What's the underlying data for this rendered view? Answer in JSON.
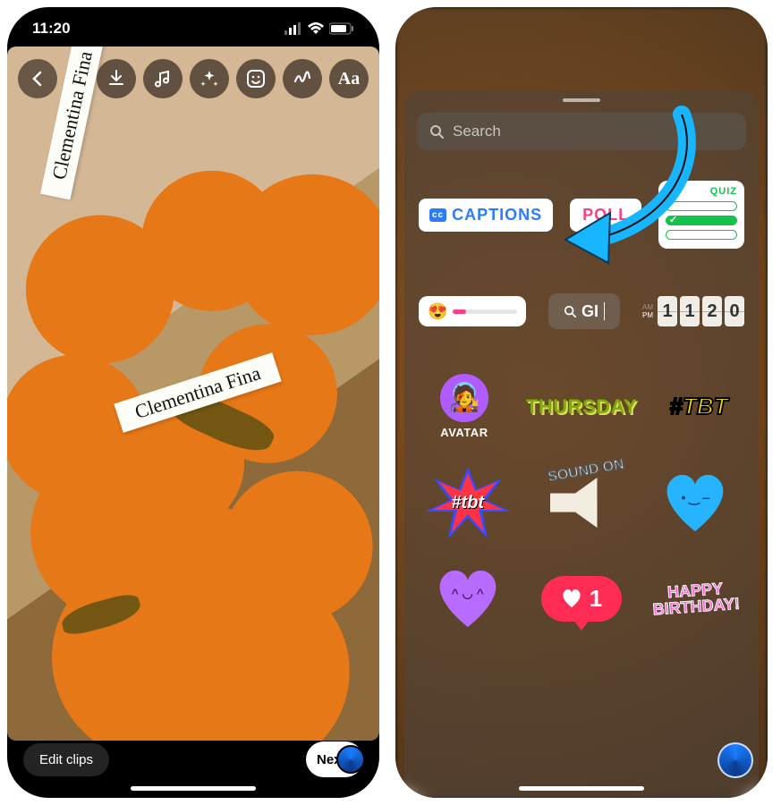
{
  "status_bar": {
    "time": "11:20",
    "cellular_bars": 3,
    "wifi": true,
    "battery_percent": 80
  },
  "editor": {
    "toolbar_icons": [
      "back",
      "download",
      "music",
      "sparkles",
      "sticker",
      "scribble",
      "text"
    ],
    "text_tool_label": "Aa",
    "product_ribbon_1": "Clementina Fina",
    "product_ribbon_2": "Clementina Fina",
    "edit_clips_label": "Edit clips",
    "next_label": "Next"
  },
  "sticker_sheet": {
    "search_placeholder": "Search",
    "row1": {
      "captions_label": "CAPTIONS",
      "captions_cc": "cc",
      "poll_label": "POLL",
      "quiz_label": "QUIZ"
    },
    "row2": {
      "slider_emoji": "😍",
      "gif_label": "GI",
      "time_ampm_top": "AM",
      "time_ampm_bottom": "PM",
      "time_digits": [
        "1",
        "1",
        "2",
        "0"
      ]
    },
    "row3": {
      "avatar_label": "AVATAR",
      "thursday_label": "THURSDAY",
      "tbt_label": "#TBT"
    },
    "row4": {
      "tbt_burst_label": "#tbt",
      "sound_on_label": "SOUND ON"
    },
    "row5": {
      "like_count": "1",
      "happy_birthday_label": "HAPPY BIRTHDAY!"
    }
  }
}
